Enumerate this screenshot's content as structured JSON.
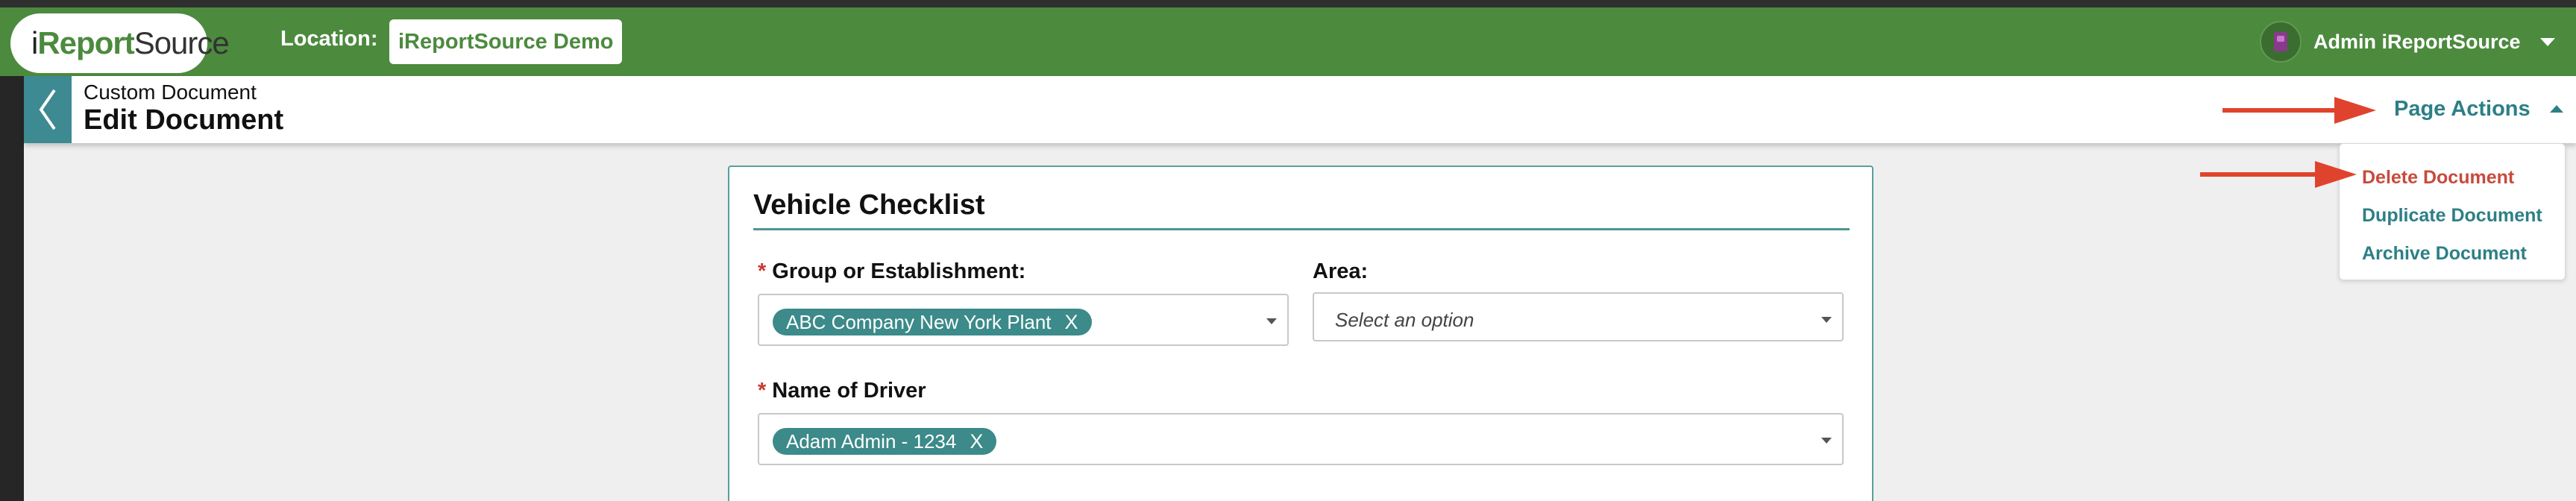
{
  "header": {
    "logo": {
      "text_i": "i",
      "text_report": "Report",
      "text_source": "Source"
    },
    "location_label": "Location:",
    "location_value": "iReportSource Demo",
    "user_name": "Admin iReportSource"
  },
  "subheader": {
    "breadcrumb": "Custom Document",
    "title": "Edit Document",
    "page_actions_label": "Page Actions"
  },
  "page_actions_menu": {
    "items": [
      {
        "label": "Delete Document"
      },
      {
        "label": "Duplicate Document"
      },
      {
        "label": "Archive Document"
      }
    ]
  },
  "form": {
    "title": "Vehicle Checklist",
    "group_field": {
      "label": "Group or Establishment:",
      "required_mark": "*",
      "selected": "ABC Company New York Plant",
      "remove": "X"
    },
    "area_field": {
      "label": "Area:",
      "placeholder": "Select an option"
    },
    "driver_field": {
      "label": "Name of Driver",
      "required_mark": "*",
      "selected": "Adam Admin - 1234",
      "remove": "X"
    }
  },
  "colors": {
    "header_green": "#4c8a3e",
    "teal": "#2d7f86",
    "danger_red": "#c84a3c",
    "annotation_arrow": "#e0432d"
  },
  "icons": [
    "logo-diamond-icon",
    "user-avatar-icon",
    "chevron-down-icon",
    "back-chevron-icon",
    "chevron-up-icon"
  ]
}
